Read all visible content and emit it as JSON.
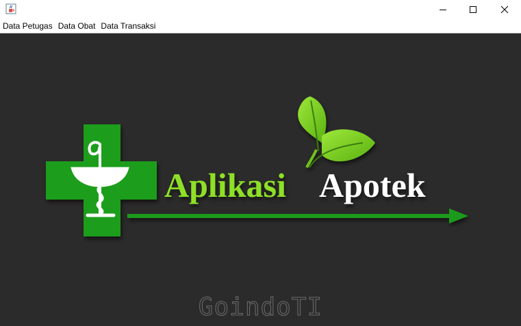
{
  "window": {
    "icon": "java-cup-icon",
    "controls": [
      "minimize-icon",
      "maximize-icon",
      "close-icon"
    ]
  },
  "menubar": {
    "items": [
      "Data Petugas",
      "Data Obat",
      "Data Transaksi"
    ]
  },
  "logo": {
    "word1": "Aplikasi",
    "word2": "Apotek",
    "colors": {
      "cross": "#1e9e1e",
      "word1": "#8ee028",
      "word2": "#ffffff",
      "arrow": "#1b9a1b",
      "leaf": "#7cd11c"
    },
    "icons": [
      "pharmacy-cross-icon",
      "bowl-of-hygieia-icon",
      "leaf-icon",
      "arrow-icon"
    ]
  },
  "watermark": "GoindoTI",
  "background": "#2b2b2b"
}
